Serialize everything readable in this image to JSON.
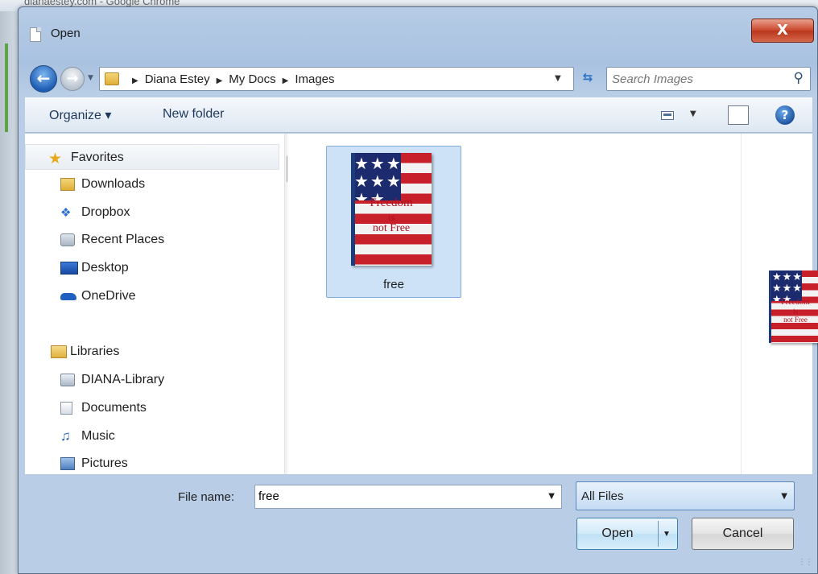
{
  "background_window": {
    "title": "dianaestey.com - Google Chrome"
  },
  "dialog": {
    "title": "Open",
    "close_label": "X"
  },
  "navigation": {
    "breadcrumbs": [
      "Diana Estey",
      "My Docs",
      "Images"
    ],
    "search_placeholder": "Search Images"
  },
  "toolbar": {
    "organize_label": "Organize ▾",
    "new_folder_label": "New folder"
  },
  "nav_pane": {
    "items": [
      {
        "label": "Favorites",
        "icon": "star-icon",
        "group": true
      },
      {
        "label": "Downloads",
        "icon": "downloads-folder-icon"
      },
      {
        "label": "Dropbox",
        "icon": "dropbox-icon"
      },
      {
        "label": "Recent Places",
        "icon": "recent-places-icon"
      },
      {
        "label": "Desktop",
        "icon": "desktop-icon"
      },
      {
        "label": "OneDrive",
        "icon": "onedrive-icon"
      },
      {
        "label": "Libraries",
        "icon": "libraries-icon",
        "group": true
      },
      {
        "label": "DIANA-Library",
        "icon": "library-icon"
      },
      {
        "label": "Documents",
        "icon": "documents-icon"
      },
      {
        "label": "Music",
        "icon": "music-icon"
      },
      {
        "label": "Pictures",
        "icon": "pictures-icon"
      }
    ]
  },
  "files": [
    {
      "name": "free",
      "selected": true,
      "thumbnail_text": [
        "Freedom",
        "is",
        "not Free"
      ]
    }
  ],
  "bottom": {
    "file_name_label": "File name:",
    "file_name_value": "free",
    "file_type": "All Files",
    "open_label": "Open",
    "cancel_label": "Cancel"
  },
  "colors": {
    "selection": "#cde2f7",
    "accent": "#1e5db4",
    "close_red": "#c9462b"
  }
}
